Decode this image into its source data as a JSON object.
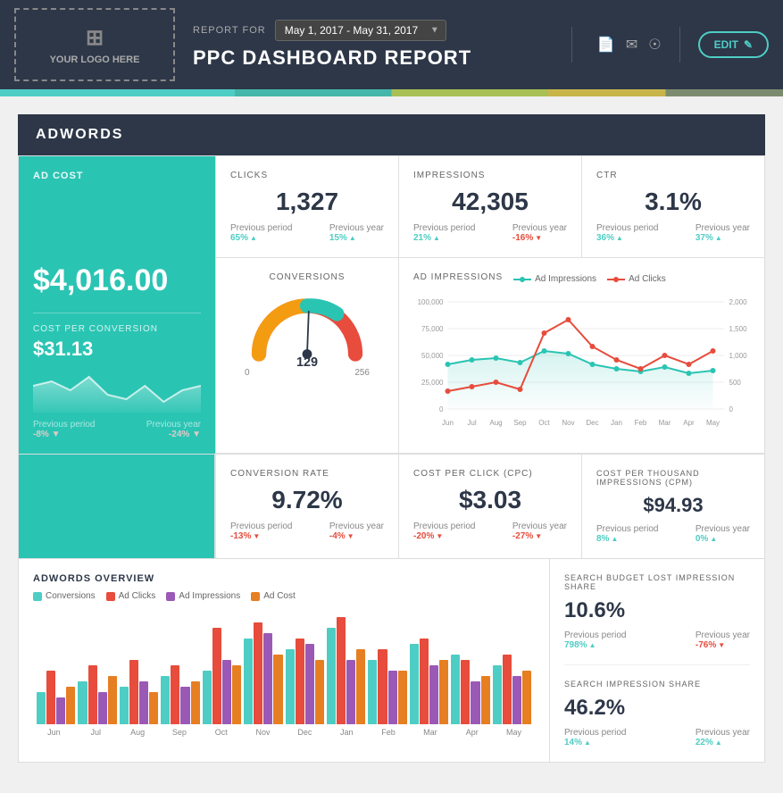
{
  "header": {
    "logo_text": "YOUR LOGO HERE",
    "report_for_label": "REPORT FOR",
    "date_range": "May 1, 2017 - May 31, 2017",
    "title": "PPC DASHBOARD REPORT",
    "edit_label": "EDIT"
  },
  "adwords": {
    "section_label": "ADWORDS",
    "ad_cost": {
      "label": "AD COST",
      "value": "$4,016.00",
      "cost_per_conversion_label": "COST PER CONVERSION",
      "cost_per_conversion_value": "$31.13",
      "prev_period_label": "Previous period",
      "prev_period_value": "-8%",
      "prev_period_direction": "down",
      "prev_year_label": "Previous year",
      "prev_year_value": "-24%",
      "prev_year_direction": "down"
    },
    "clicks": {
      "label": "CLICKS",
      "value": "1,327",
      "prev_period_label": "Previous period",
      "prev_period_value": "65%",
      "prev_period_direction": "up",
      "prev_year_label": "Previous year",
      "prev_year_value": "15%",
      "prev_year_direction": "up"
    },
    "impressions": {
      "label": "IMPRESSIONS",
      "value": "42,305",
      "prev_period_label": "Previous period",
      "prev_period_value": "21%",
      "prev_period_direction": "up",
      "prev_year_label": "Previous year",
      "prev_year_value": "-16%",
      "prev_year_direction": "down"
    },
    "ctr": {
      "label": "CTR",
      "value": "3.1%",
      "prev_period_label": "Previous period",
      "prev_period_value": "36%",
      "prev_period_direction": "up",
      "prev_year_label": "Previous year",
      "prev_year_value": "37%",
      "prev_year_direction": "up"
    },
    "conversions": {
      "label": "CONVERSIONS",
      "value": "129",
      "gauge_min": "0",
      "gauge_max": "256"
    },
    "ad_impressions_chart": {
      "label": "AD IMPRESSIONS",
      "legend_impressions": "Ad Impressions",
      "legend_clicks": "Ad Clicks",
      "x_labels": [
        "Jun",
        "Jul",
        "Aug",
        "Sep",
        "Oct",
        "Nov",
        "Dec",
        "Jan",
        "Feb",
        "Mar",
        "Apr",
        "May"
      ],
      "y_left_max": "100,000",
      "y_right_max": "2,000"
    },
    "conversion_rate": {
      "label": "CONVERSION RATE",
      "value": "9.72%",
      "prev_period_label": "Previous period",
      "prev_period_value": "-13%",
      "prev_period_direction": "down",
      "prev_year_label": "Previous year",
      "prev_year_value": "-4%",
      "prev_year_direction": "down"
    },
    "cpc": {
      "label": "COST PER CLICK (CPC)",
      "value": "$3.03",
      "prev_period_label": "Previous period",
      "prev_period_value": "-20%",
      "prev_period_direction": "down",
      "prev_year_label": "Previous year",
      "prev_year_value": "-27%",
      "prev_year_direction": "down"
    },
    "cpm": {
      "label": "COST PER THOUSAND IMPRESSIONS (CPM)",
      "value": "$94.93",
      "prev_period_label": "Previous period",
      "prev_period_value": "8%",
      "prev_period_direction": "up",
      "prev_year_label": "Previous year",
      "prev_year_value": "0%",
      "prev_year_direction": "up"
    },
    "overview": {
      "label": "ADWORDS OVERVIEW",
      "legend": [
        {
          "label": "Conversions",
          "color": "#4ecdc4"
        },
        {
          "label": "Ad Clicks",
          "color": "#e74c3c"
        },
        {
          "label": "Ad Impressions",
          "color": "#9b59b6"
        },
        {
          "label": "Ad Cost",
          "color": "#e67e22"
        }
      ],
      "months": [
        "Jun",
        "Jul",
        "Aug",
        "Sep",
        "Oct",
        "Nov",
        "Dec",
        "Jan",
        "Feb",
        "Mar",
        "Apr",
        "May"
      ],
      "bars": {
        "conversions": [
          30,
          40,
          35,
          45,
          50,
          80,
          70,
          90,
          60,
          75,
          65,
          55
        ],
        "ad_clicks": [
          50,
          55,
          60,
          55,
          90,
          95,
          80,
          100,
          70,
          80,
          60,
          65
        ],
        "ad_impressions": [
          25,
          30,
          40,
          35,
          60,
          85,
          75,
          60,
          50,
          55,
          40,
          45
        ],
        "ad_cost": [
          35,
          45,
          30,
          40,
          55,
          65,
          60,
          70,
          50,
          60,
          45,
          50
        ]
      }
    },
    "search_budget": {
      "label": "SEARCH BUDGET LOST IMPRESSION SHARE",
      "value": "10.6%",
      "prev_period_label": "Previous period",
      "prev_period_value": "798%",
      "prev_period_direction": "up",
      "prev_year_label": "Previous year",
      "prev_year_value": "-76%",
      "prev_year_direction": "down"
    },
    "search_impression": {
      "label": "SEARCH IMPRESSION SHARE",
      "value": "46.2%",
      "prev_period_label": "Previous period",
      "prev_period_value": "14%",
      "prev_period_direction": "up",
      "prev_year_label": "Previous year",
      "prev_year_value": "22%",
      "prev_year_direction": "up"
    }
  },
  "colors": {
    "teal": "#2ac4b3",
    "dark": "#2d3748",
    "red": "#e74c3c",
    "up": "#4ecdc4",
    "down": "#e74c3c",
    "purple": "#9b59b6",
    "orange": "#e67e22"
  }
}
